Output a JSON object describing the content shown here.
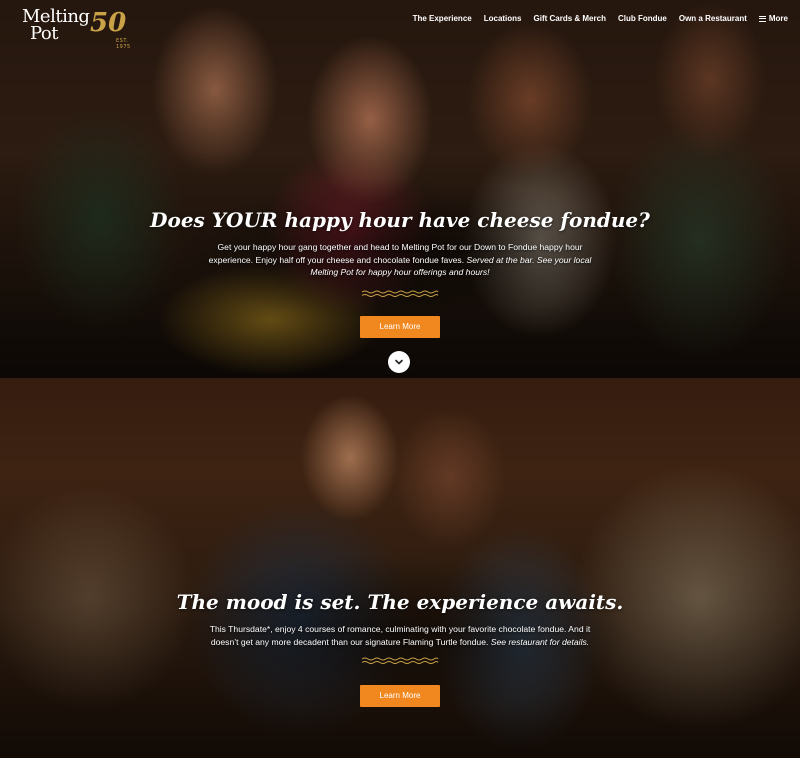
{
  "brand": {
    "logo_line1": "Melting",
    "logo_line2": "Pot",
    "anniversary": "50",
    "est": "EST. 1975"
  },
  "nav": {
    "items": [
      {
        "label": "The Experience"
      },
      {
        "label": "Locations"
      },
      {
        "label": "Gift Cards & Merch"
      },
      {
        "label": "Club Fondue"
      },
      {
        "label": "Own a Restaurant"
      }
    ],
    "more_label": "More",
    "more_icon": "hamburger-menu-icon"
  },
  "hero1": {
    "title": "Does YOUR happy hour have cheese fondue?",
    "body_plain": "Get your happy hour gang together and head to Melting Pot for our Down to Fondue happy hour experience. Enjoy half off your cheese and chocolate fondue faves. ",
    "body_italic": "Served at the bar. See your local Melting Pot for happy hour offerings and hours!",
    "button_label": "Learn More",
    "scroll_icon": "chevron-down-icon"
  },
  "hero2": {
    "title": "The mood is set. The experience awaits.",
    "body_plain": "This Thursdate*, enjoy 4 courses of romance, culminating with your favorite chocolate fondue. And it doesn’t get any more decadent than our signature Flaming Turtle fondue. ",
    "body_italic": "See restaurant for details.",
    "button_label": "Learn More"
  },
  "colors": {
    "accent": "#f0881f",
    "gold": "#c9a248"
  }
}
